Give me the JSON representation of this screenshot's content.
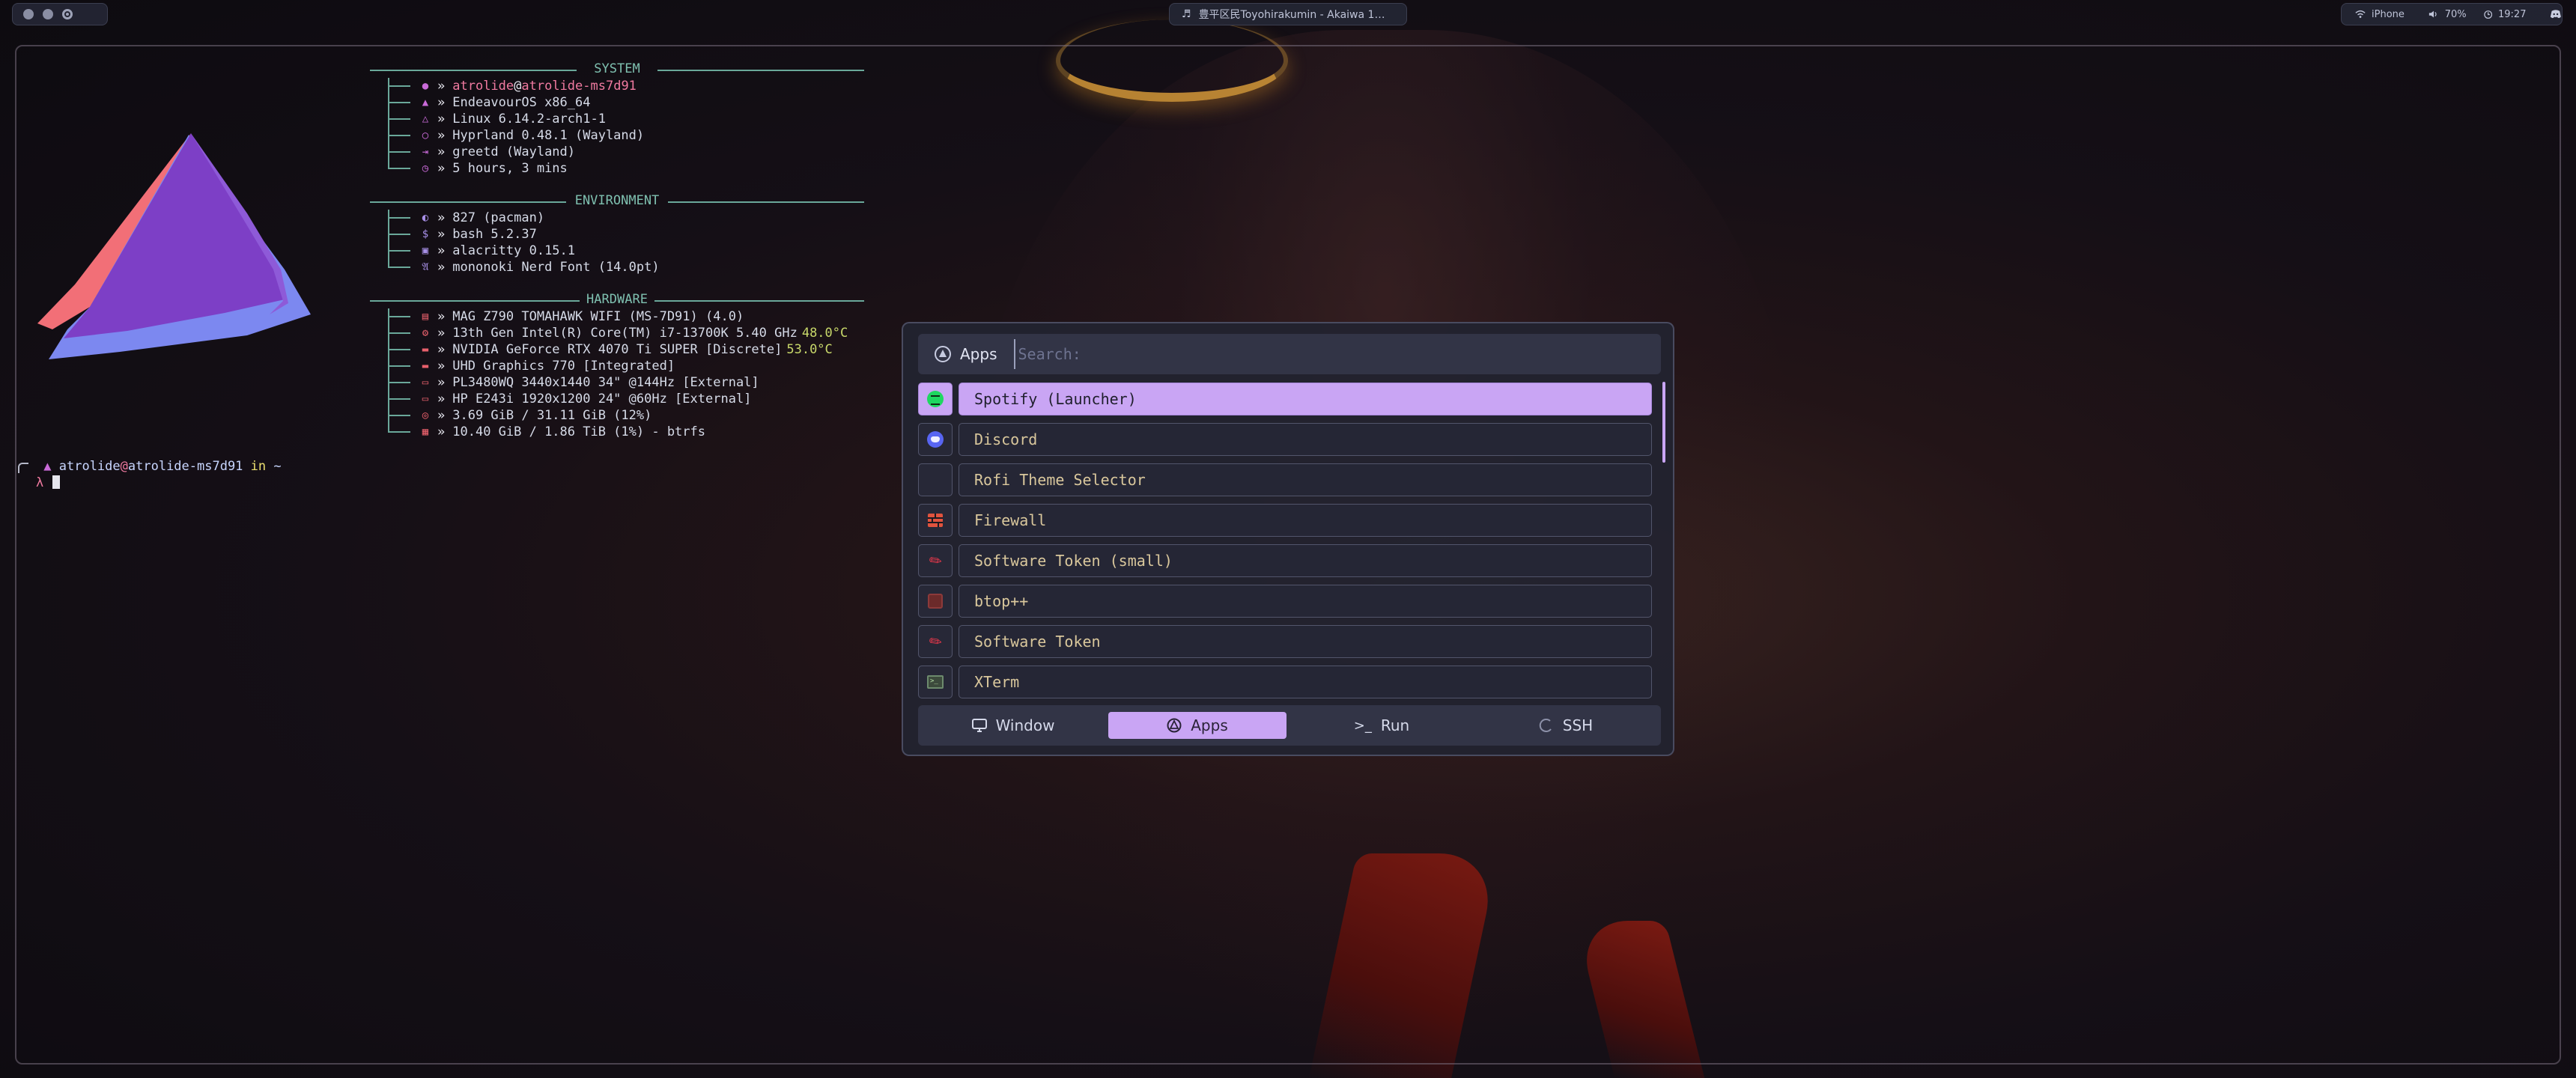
{
  "topbar": {
    "media_icon": "music-note-icon",
    "media_title": "豊平区民Toyohirakumin - Akaiwa 1…",
    "status": {
      "wifi_label": "iPhone",
      "volume_label": "70%",
      "clock_label": "19:27"
    }
  },
  "fastfetch": {
    "sections": {
      "system": "SYSTEM",
      "environment": "ENVIRONMENT",
      "hardware": "HARDWARE"
    },
    "system": [
      {
        "icon": "user-icon",
        "user": "atrolide",
        "at": "@",
        "host": "atrolide-ms7d91"
      },
      {
        "icon": "endeavouros-icon",
        "value": "EndeavourOS x86_64"
      },
      {
        "icon": "kernel-icon",
        "value": "Linux 6.14.2-arch1-1"
      },
      {
        "icon": "hyprland-icon",
        "value": "Hyprland 0.48.1 (Wayland)"
      },
      {
        "icon": "login-icon",
        "value": "greetd (Wayland)"
      },
      {
        "icon": "clock-icon",
        "value": "5 hours, 3 mins"
      }
    ],
    "environment": [
      {
        "icon": "package-icon",
        "value": "827 (pacman)"
      },
      {
        "icon": "shell-icon",
        "value": "bash 5.2.37"
      },
      {
        "icon": "terminal-icon",
        "value": "alacritty 0.15.1"
      },
      {
        "icon": "font-icon",
        "value": "mononoki Nerd Font (14.0pt)"
      }
    ],
    "hardware": [
      {
        "icon": "motherboard-icon",
        "value": "MAG Z790 TOMAHAWK WIFI (MS-7D91) (4.0)"
      },
      {
        "icon": "cpu-icon",
        "value": "13th Gen Intel(R) Core(TM) i7-13700K 5.40 GHz",
        "temp": "48.0°C"
      },
      {
        "icon": "gpu-icon",
        "value": "NVIDIA GeForce RTX 4070 Ti SUPER [Discrete]",
        "temp": "53.0°C"
      },
      {
        "icon": "gpu-icon",
        "value": "UHD Graphics 770 [Integrated]"
      },
      {
        "icon": "monitor-icon",
        "value": "PL3480WQ 3440x1440 34\" @144Hz [External]"
      },
      {
        "icon": "monitor-icon",
        "value": "HP E243i 1920x1200 24\" @60Hz [External]"
      },
      {
        "icon": "memory-icon",
        "value": "3.69 GiB / 31.11 GiB (12%)"
      },
      {
        "icon": "disk-icon",
        "value": "10.40 GiB / 1.86 TiB (1%) - btrfs"
      }
    ],
    "arrow": "»"
  },
  "prompt": {
    "user": "atrolide",
    "at": "@",
    "host": "atrolide-ms7d91",
    "in": "in",
    "dir": "~",
    "symbol": "λ"
  },
  "rofi": {
    "mode_label": "Apps",
    "search_placeholder": "Search:",
    "search_value": "",
    "items": [
      {
        "label": "Spotify (Launcher)",
        "icon": "spotify-icon",
        "selected": true
      },
      {
        "label": "Discord",
        "icon": "discord-icon"
      },
      {
        "label": "Rofi Theme Selector",
        "icon": ""
      },
      {
        "label": "Firewall",
        "icon": "firewall-icon"
      },
      {
        "label": "Software Token (small)",
        "icon": "token-icon"
      },
      {
        "label": "btop++",
        "icon": "btop-icon"
      },
      {
        "label": "Software Token",
        "icon": "token-icon"
      },
      {
        "label": "XTerm",
        "icon": "xterm-icon"
      }
    ],
    "modes": [
      {
        "label": "Window",
        "icon": "monitor-icon"
      },
      {
        "label": "Apps",
        "icon": "apps-icon",
        "active": true
      },
      {
        "label": "Run",
        "icon": "run-icon"
      },
      {
        "label": "SSH",
        "icon": "ssh-icon"
      }
    ]
  },
  "colors": {
    "accent": "#c9a5f4",
    "tree": "#6aa89a",
    "app_label": "#d9c79c"
  }
}
